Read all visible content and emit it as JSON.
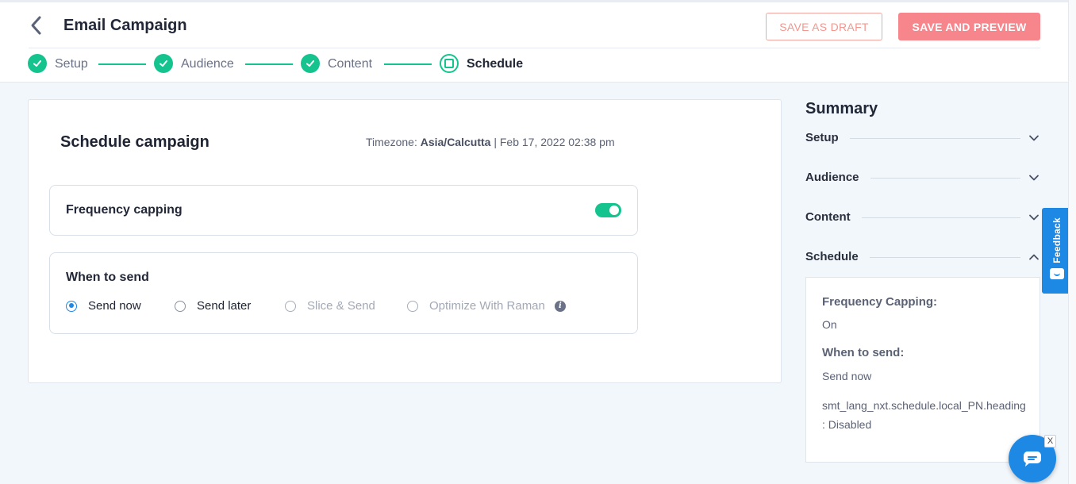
{
  "header": {
    "title": "Email Campaign",
    "save_draft_label": "SAVE AS DRAFT",
    "save_preview_label": "SAVE AND PREVIEW"
  },
  "steps": [
    {
      "label": "Setup",
      "state": "done"
    },
    {
      "label": "Audience",
      "state": "done"
    },
    {
      "label": "Content",
      "state": "done"
    },
    {
      "label": "Schedule",
      "state": "active"
    }
  ],
  "schedule": {
    "title": "Schedule campaign",
    "timezone_prefix": "Timezone:",
    "timezone": "Asia/Calcutta",
    "datetime": "| Feb 17, 2022 02:38 pm",
    "frequency_capping_label": "Frequency capping",
    "frequency_capping_on": true,
    "when_to_send_label": "When to send",
    "options": [
      {
        "label": "Send now",
        "selected": true,
        "disabled": false
      },
      {
        "label": "Send later",
        "selected": false,
        "disabled": false
      },
      {
        "label": "Slice & Send",
        "selected": false,
        "disabled": true
      },
      {
        "label": "Optimize With Raman",
        "selected": false,
        "disabled": true
      }
    ]
  },
  "summary": {
    "title": "Summary",
    "sections": [
      {
        "label": "Setup",
        "expanded": false
      },
      {
        "label": "Audience",
        "expanded": false
      },
      {
        "label": "Content",
        "expanded": false
      },
      {
        "label": "Schedule",
        "expanded": true
      }
    ],
    "panel": {
      "freq_heading": "Frequency Capping:",
      "freq_value": "On",
      "when_heading": "When to send:",
      "when_value": "Send now",
      "local_pn_key": "smt_lang_nxt.schedule.local_PN.heading",
      "local_pn_value": ": Disabled"
    }
  },
  "feedback_label": "Feedback",
  "chat_close_label": "X",
  "colors": {
    "accent_green": "#14c38e",
    "primary_blue": "#1e88e5",
    "preview_pink": "#f7858c"
  }
}
